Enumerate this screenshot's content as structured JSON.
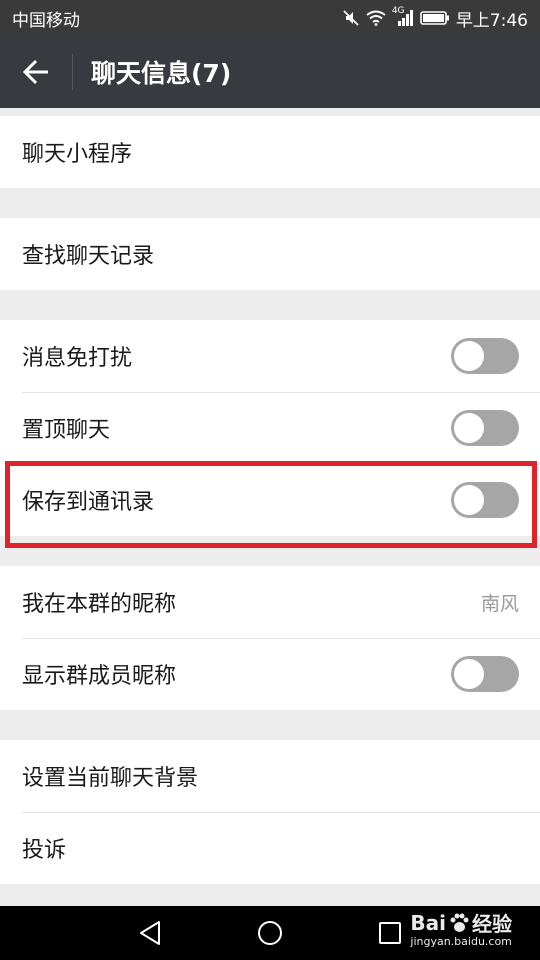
{
  "status": {
    "carrier": "中国移动",
    "network": "4G",
    "time": "早上7:46"
  },
  "header": {
    "title": "聊天信息(7)"
  },
  "groups": [
    {
      "rows": [
        {
          "label": "聊天小程序"
        }
      ]
    },
    {
      "rows": [
        {
          "label": "查找聊天记录"
        }
      ]
    },
    {
      "rows": [
        {
          "label": "消息免打扰",
          "toggle_on": false
        },
        {
          "label": "置顶聊天",
          "toggle_on": false
        },
        {
          "label": "保存到通讯录",
          "toggle_on": false
        }
      ]
    },
    {
      "rows": [
        {
          "label": "我在本群的昵称",
          "value": "南风"
        },
        {
          "label": "显示群成员昵称",
          "toggle_on": false
        }
      ]
    },
    {
      "rows": [
        {
          "label": "设置当前聊天背景"
        },
        {
          "label": "投诉"
        }
      ]
    }
  ],
  "watermark": {
    "brand_left": "Bai",
    "brand_right": "经验",
    "url": "jingyan.baidu.com"
  },
  "colors": {
    "header_bg": "#393a3f",
    "highlight_border": "#e0232a",
    "toggle_off": "#a6a6a6"
  }
}
